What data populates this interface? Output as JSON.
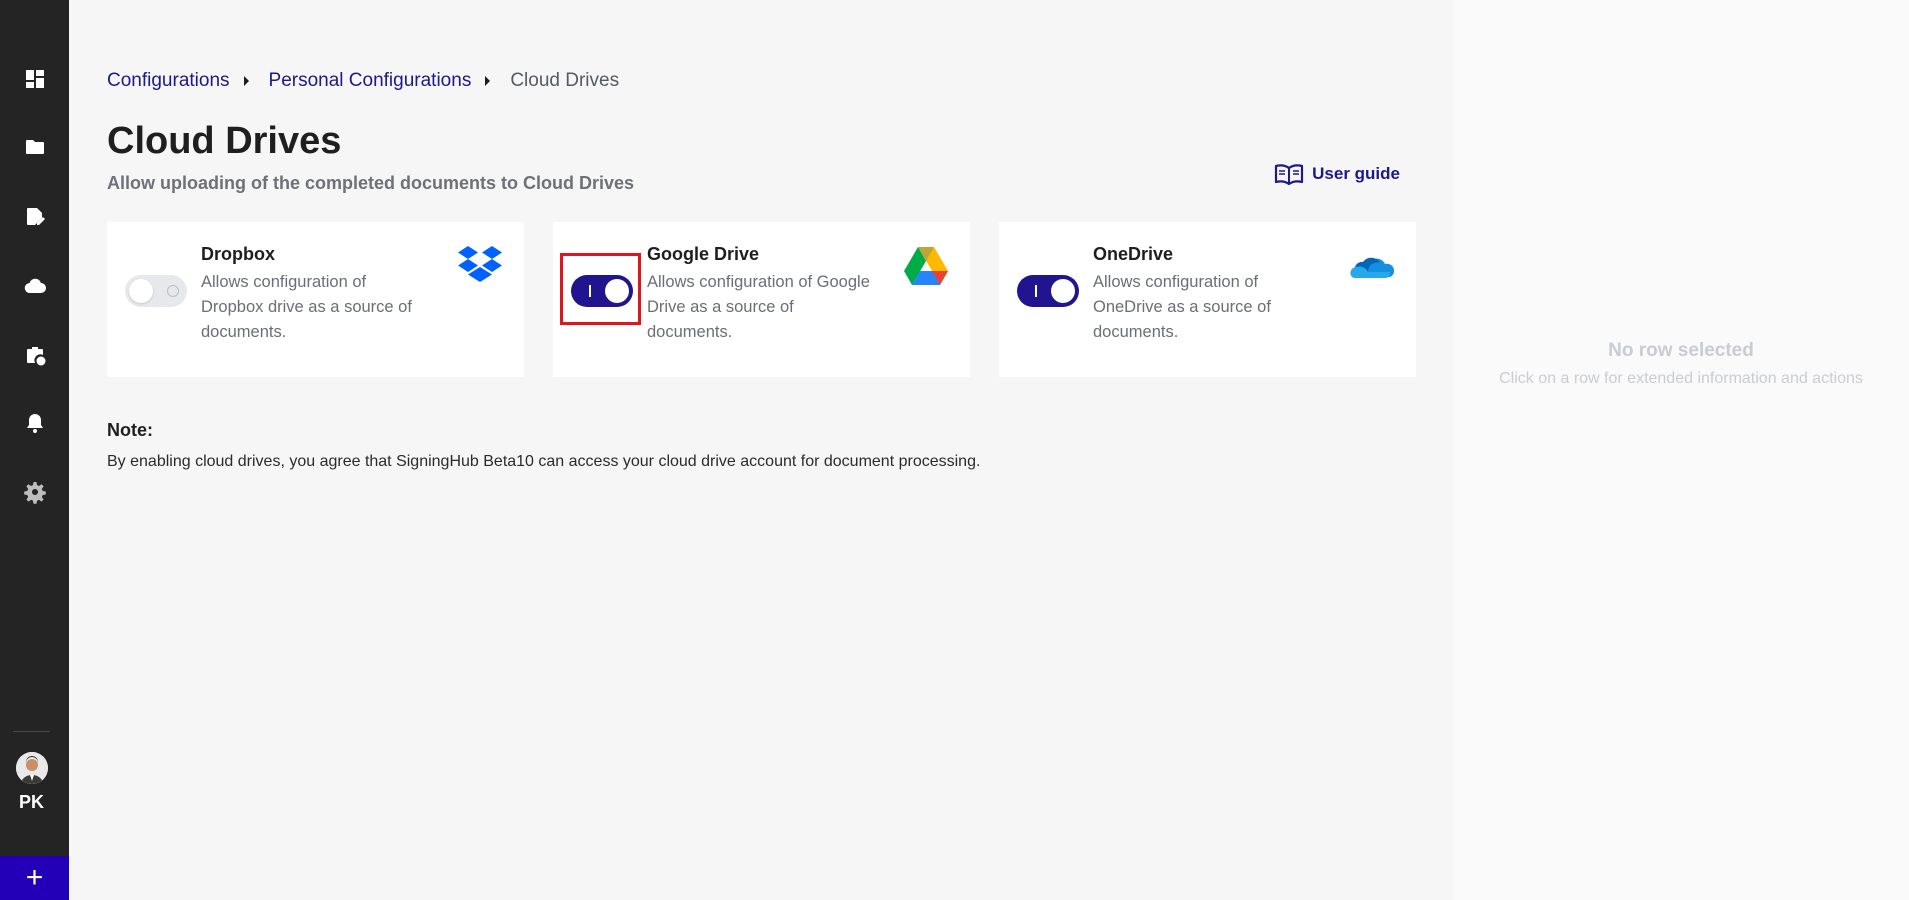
{
  "sidebar": {
    "items": [
      {
        "icon": "dashboard-icon"
      },
      {
        "icon": "folder-icon"
      },
      {
        "icon": "document-edit-icon"
      },
      {
        "icon": "cloud-icon"
      },
      {
        "icon": "briefcase-clock-icon"
      },
      {
        "icon": "bell-icon"
      },
      {
        "icon": "gear-icon"
      }
    ],
    "user_initials": "PK",
    "add_label": "+"
  },
  "breadcrumb": {
    "items": [
      "Configurations",
      "Personal Configurations",
      "Cloud Drives"
    ]
  },
  "header": {
    "title": "Cloud Drives",
    "subtitle": "Allow uploading of the completed documents to Cloud Drives",
    "user_guide": "User guide"
  },
  "drives": [
    {
      "name": "Dropbox",
      "description": "Allows configuration of Dropbox drive as a source of documents.",
      "enabled": false,
      "logo": "dropbox-logo"
    },
    {
      "name": "Google Drive",
      "description": "Allows configuration of Google Drive as a source of documents.",
      "enabled": true,
      "logo": "google-drive-logo"
    },
    {
      "name": "OneDrive",
      "description": "Allows configuration of OneDrive as a source of documents.",
      "enabled": true,
      "logo": "onedrive-logo"
    }
  ],
  "note": {
    "title": "Note:",
    "text": "By enabling cloud drives, you agree that SigningHub Beta10 can access your cloud drive account for document processing."
  },
  "right_panel": {
    "title": "No row selected",
    "text": "Click on a row for extended information and actions"
  },
  "colors": {
    "accent": "#20148f",
    "sidebar": "#242424",
    "add_button": "#2300b8",
    "highlight": "#e0161f"
  }
}
